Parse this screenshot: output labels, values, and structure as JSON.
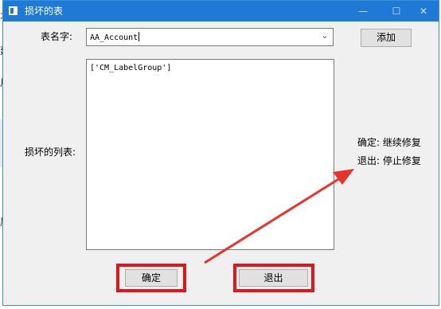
{
  "background": {
    "fragments": [
      "不",
      "建",
      "用",
      "属"
    ]
  },
  "dialog": {
    "title": "损坏的表",
    "window_buttons": {
      "minimize": "—",
      "maximize": "☐",
      "close": "✕"
    },
    "table_name_label": "表名字:",
    "table_name_value": "AA_Account",
    "add_button": "添加",
    "damaged_list_label": "损坏的列表:",
    "damaged_list_content": "['CM_LabelGroup']",
    "hint_confirm": "确定: 继续修复",
    "hint_exit": "退出: 停止修复",
    "ok_button": "确定",
    "exit_button": "退出"
  },
  "annotation": {
    "highlight_color": "#e0161b",
    "arrow_color": "#e8342c"
  },
  "colors": {
    "titlebar": "#1f7ad6",
    "dialog_bg": "#f0f0f0",
    "button_bg": "#e1e1e1"
  }
}
